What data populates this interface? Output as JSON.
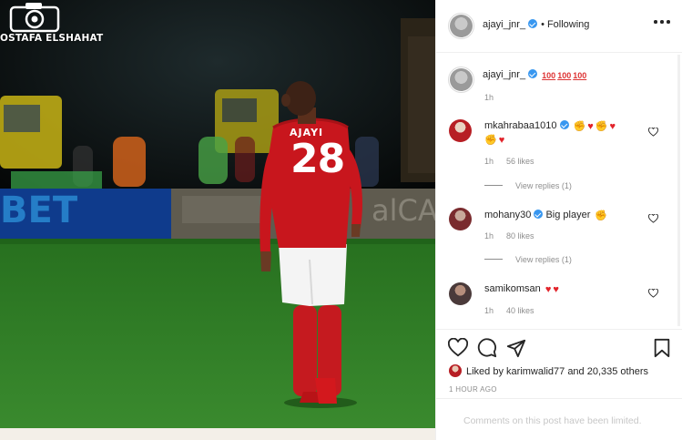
{
  "photo": {
    "watermark_text": "OSTAFA ELSHAHAT",
    "ad_board_left": "BET",
    "ad_board_right": "alCA",
    "jersey_name": "AJAYI",
    "jersey_number": "28"
  },
  "header": {
    "username": "ajayi_jnr_",
    "separator": "•",
    "follow_status": "Following"
  },
  "comments": [
    {
      "user": "ajayi_jnr_",
      "verified": true,
      "text": "",
      "emoji": [
        "hundred-emoji",
        "hundred-emoji",
        "hundred-emoji"
      ],
      "time": "1h",
      "likes": ""
    },
    {
      "user": "mkahrabaa1010",
      "verified": true,
      "text": "",
      "emoji_line1": [
        "flex-emoji",
        "red-heart-emoji",
        "flex-emoji",
        "red-heart-emoji"
      ],
      "emoji_line2": [
        "flex-emoji",
        "red-heart-emoji"
      ],
      "time": "1h",
      "likes": "56 likes",
      "replies": "View replies (1)"
    },
    {
      "user": "mohany30",
      "verified": true,
      "text": "Big player",
      "emoji": [
        "flex-emoji"
      ],
      "time": "1h",
      "likes": "80 likes",
      "replies": "View replies (1)"
    },
    {
      "user": "samikomsan",
      "verified": false,
      "text": "",
      "emoji": [
        "red-heart-emoji",
        "red-heart-emoji"
      ],
      "time": "1h",
      "likes": "40 likes"
    }
  ],
  "actions": {
    "icons": [
      "heart-outline-icon",
      "comment-icon",
      "share-icon",
      "bookmark-icon"
    ],
    "liked_by_prefix": "Liked by",
    "liked_by_user": "karimwalid77",
    "liked_by_and": "and",
    "liked_by_others": "20,335 others",
    "timestamp": "1 HOUR AGO"
  },
  "footer": {
    "comments_limited": "Comments on this post have been limited."
  },
  "colors": {
    "verified": "#3897f0",
    "jersey_red": "#c8161d",
    "pitch_green": "#2f7d28",
    "meta_grey": "#8e8e8e"
  }
}
